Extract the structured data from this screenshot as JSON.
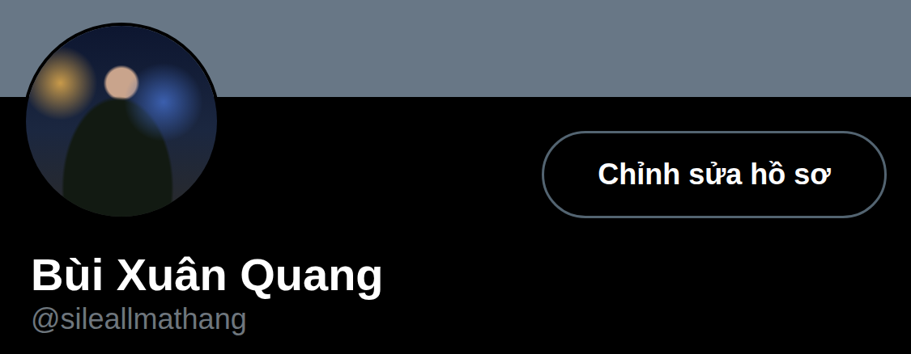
{
  "profile": {
    "name": "Bùi Xuân Quang",
    "handle": "@sileallmathang"
  },
  "buttons": [
    {
      "label": "Chỉnh sửa hồ sơ"
    }
  ]
}
